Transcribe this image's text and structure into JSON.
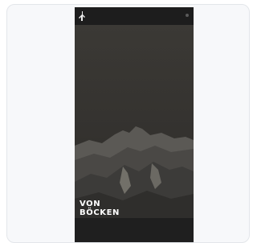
{
  "hero": {
    "title_line1": "VON",
    "title_line2": "BÖCKEN"
  },
  "icons": {
    "logo": "logo-icon",
    "menu": "menu-dot-icon"
  },
  "colors": {
    "card_background": "#f7f8fa",
    "card_border": "#e3e6ea",
    "phone_background": "#262626",
    "topbar": "#1d1d1d",
    "hero_title": "#ffffff"
  }
}
